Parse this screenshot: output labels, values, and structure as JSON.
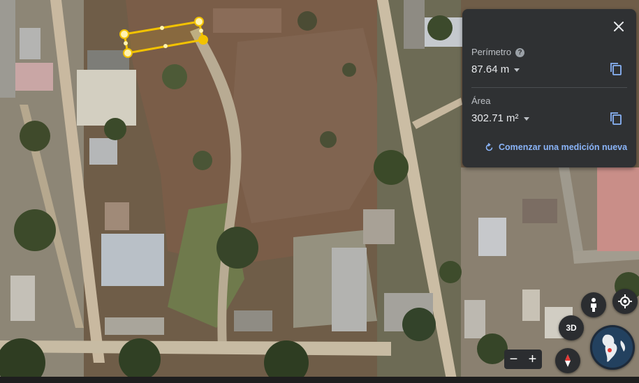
{
  "measure_panel": {
    "perimeter_label": "Perímetro",
    "perimeter_value": "87.64 m",
    "area_label": "Área",
    "area_value": "302.71 m²",
    "new_measure_label": "Comenzar una medición nueva"
  },
  "map_controls": {
    "view_3d_label": "3D",
    "zoom_out_label": "−",
    "zoom_in_label": "+"
  },
  "colors": {
    "panel_bg": "#2f3133",
    "measure_line": "#f2c200",
    "accent_link": "#8ab4f8"
  },
  "icons": [
    "close-icon",
    "help-icon",
    "chevron-down-icon",
    "copy-icon",
    "refresh-icon",
    "pegman-icon",
    "my-location-icon",
    "compass-icon",
    "globe-icon"
  ]
}
